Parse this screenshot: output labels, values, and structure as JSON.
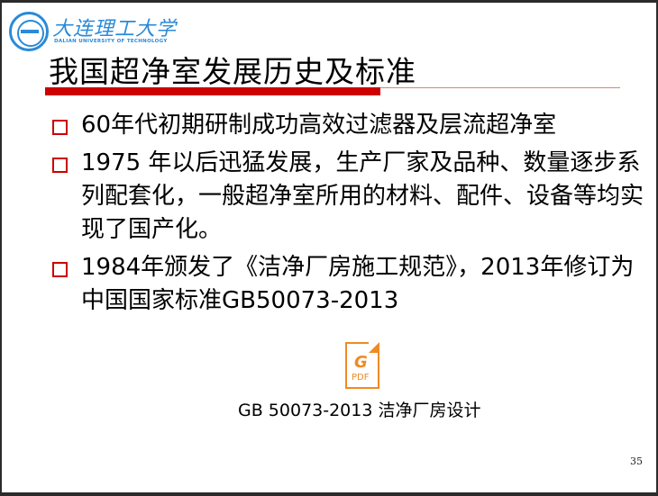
{
  "header": {
    "university_cn": "大连理工大学",
    "university_en": "DALIAN UNIVERSITY OF TECHNOLOGY"
  },
  "title": "我国超净室发展历史及标准",
  "bullets": [
    "60年代初期研制成功高效过滤器及层流超净室",
    "1975 年以后迅猛发展，生产厂家及品种、数量逐步系列配套化，一般超净室所用的材料、配件、设备等均实现了国产化。",
    "1984年颁发了《洁净厂房施工规范》，2013年修订为中国国家标准GB50073-2013"
  ],
  "attachment": {
    "icon_label": "PDF",
    "caption": "GB 50073-2013 洁净厂房设计"
  },
  "page_number": "35",
  "colors": {
    "accent": "#cc0000",
    "logo": "#2a8ad8",
    "pdf": "#f08a24"
  }
}
